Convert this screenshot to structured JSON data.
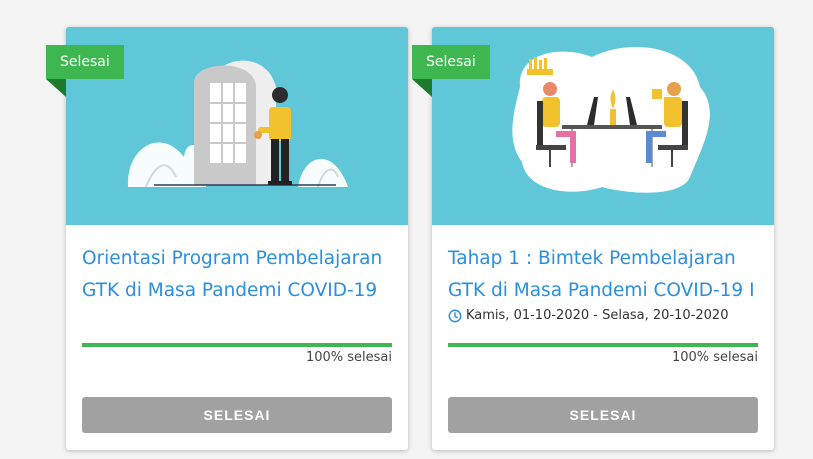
{
  "colors": {
    "page_bg": "#f3f3f3",
    "illustration_bg": "#5fc7d7",
    "ribbon": "#3fb750",
    "title": "#2b8fe0",
    "progress": "#3fb750",
    "button": "#a1a1a1"
  },
  "cards": [
    {
      "ribbon_label": "Selesai",
      "title": "Orientasi Program Pembelajaran GTK di Masa Pandemi COVID-19",
      "progress_fraction": 1.0,
      "progress_text": "100% selesai",
      "button_label": "SELESAI"
    },
    {
      "ribbon_label": "Selesai",
      "title": "Tahap 1 : Bimtek Pembelajaran GTK di Masa Pandemi COVID-19 I",
      "date_icon": "clock-icon",
      "date_range": "Kamis, 01-10-2020 - Selasa, 20-10-2020",
      "progress_fraction": 1.0,
      "progress_text": "100% selesai",
      "button_label": "SELESAI"
    }
  ]
}
